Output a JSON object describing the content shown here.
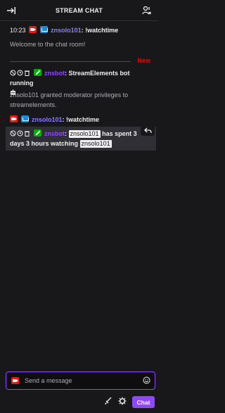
{
  "header": {
    "title": "STREAM CHAT",
    "collapse_icon": "arrow-collapse-icon",
    "users_icon": "community-icon"
  },
  "messages": [
    {
      "time": "10:23",
      "user": "znsolo101",
      "text": ": !watchtime"
    },
    {
      "system": "Welcome to the chat room!"
    },
    {
      "user": "znsbot",
      "text": ": StreamElements bot running"
    },
    {
      "system": "znsolo101 granted moderator privileges to streamelements."
    },
    {
      "user": "znsolo101",
      "text": ": !watchtime"
    },
    {
      "user": "znsbot",
      "mention1": "znsolo101",
      "text_mid": "has spent 3",
      "text_line2": "days 3 hours watching",
      "mention2": "znsolo101"
    }
  ],
  "divider": {
    "label": "New"
  },
  "input": {
    "placeholder": "Send a message"
  },
  "footer": {
    "chat_button": "Chat"
  },
  "colors": {
    "accent": "#9147ff",
    "broadcaster": "#e91916",
    "new_divider": "#eb0400"
  }
}
